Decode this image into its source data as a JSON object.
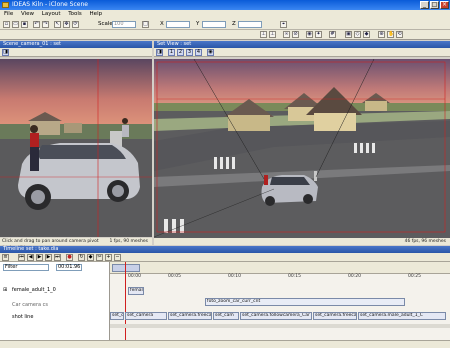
{
  "window": {
    "title": "IDEAS Kiln - iClone Scene"
  },
  "menu": [
    "File",
    "View",
    "Layout",
    "Tools",
    "Help"
  ],
  "toolbar": {
    "scale_label": "Scale",
    "scale_value": "100",
    "x_label": "X",
    "y_label": "Y",
    "z_label": "Z"
  },
  "left_panel": {
    "title": "Scene_camera_01 : set",
    "status_hint": "Click and drag to pan around camera pivot (ctrl + tilt)",
    "status_fps": "1 fps, 90 meshes"
  },
  "right_panel": {
    "title": "Set View : set",
    "tabs": [
      "1",
      "2",
      "3",
      "4"
    ],
    "status_fps": "46 fps, 96 meshes"
  },
  "timeline": {
    "title": "Timeline set : take.dia",
    "filter_label": "Filter",
    "time_value": "00:01.96",
    "ruler": [
      "00:00",
      "00:05",
      "00:10",
      "00:15",
      "00:20",
      "00:25"
    ],
    "tracks": [
      "female_adult_1_0",
      "Car camera cs",
      "shot line"
    ],
    "clips_row1": [
      "female_adult_1"
    ],
    "clips_row2": [
      "foto_zoom_car_curr_cnt"
    ],
    "clips_row3": [
      "set_c",
      "set_camera",
      "set_camera.freecam",
      "set_cam",
      "set_camera.followcamera_Car",
      "set_camera.freecam",
      "set_camera.male_adult_1_C"
    ]
  },
  "colors": {
    "titlebar": "#0a5bd8",
    "panel_header": "#3a66b8",
    "marker": "#d02020"
  }
}
